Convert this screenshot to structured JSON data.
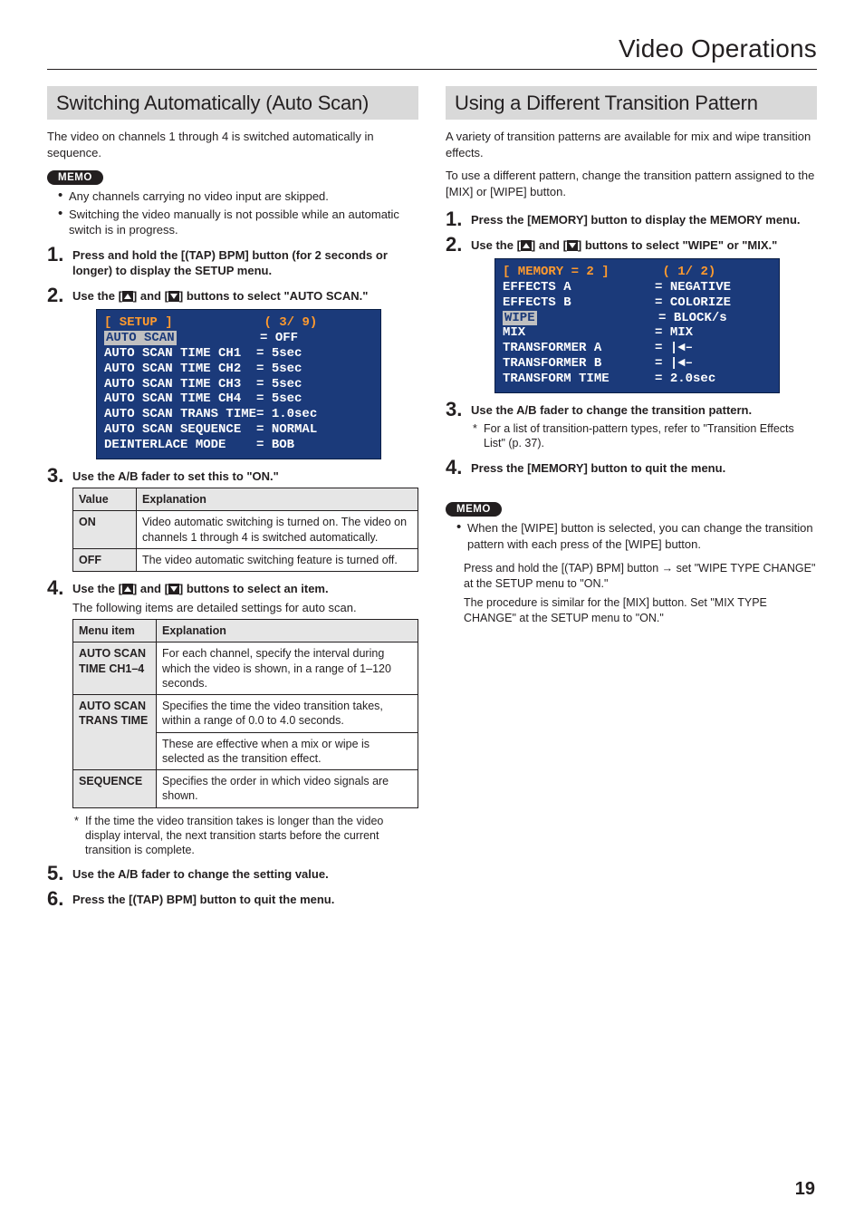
{
  "header": {
    "title": "Video Operations"
  },
  "left": {
    "section_title": "Switching Automatically (Auto Scan)",
    "intro": "The video on channels 1 through 4 is switched automatically in sequence.",
    "memo_label": "MEMO",
    "memo_items": [
      "Any channels carrying no video input are skipped.",
      "Switching the video manually is not possible while an automatic switch is in progress."
    ],
    "steps": {
      "s1": "Press and hold the [(TAP) BPM] button (for 2 seconds or longer) to display the SETUP menu.",
      "s2a": "Use the [",
      "s2b": "] and [",
      "s2c": "] buttons to select \"AUTO SCAN.\"",
      "s3": "Use the A/B fader to set this to \"ON.\"",
      "s4a": "Use the [",
      "s4b": "] and [",
      "s4c": "] buttons to select an item.",
      "s4_body": "The following items are detailed settings for auto scan.",
      "s5": "Use the A/B fader to change the setting value.",
      "s6": "Press the [(TAP) BPM] button to quit the menu."
    },
    "lcd": {
      "l1a": "[ SETUP ]",
      "l1b": "( 3/ 9)",
      "l2a": "AUTO SCAN",
      "l2b": "= OFF",
      "l3": "AUTO SCAN TIME CH1  = 5sec",
      "l4": "AUTO SCAN TIME CH2  = 5sec",
      "l5": "AUTO SCAN TIME CH3  = 5sec",
      "l6": "AUTO SCAN TIME CH4  = 5sec",
      "l7": "AUTO SCAN TRANS TIME= 1.0sec",
      "l8": "AUTO SCAN SEQUENCE  = NORMAL",
      "l9": "DEINTERLACE MODE    = BOB"
    },
    "table1": {
      "h1": "Value",
      "h2": "Explanation",
      "r1a": "ON",
      "r1b": "Video automatic switching is turned on. The video on channels 1 through 4 is switched automatically.",
      "r2a": "OFF",
      "r2b": "The video automatic switching feature is turned off."
    },
    "table2": {
      "h1": "Menu item",
      "h2": "Explanation",
      "r1a": "AUTO SCAN TIME CH1–4",
      "r1b": "For each channel, specify the interval during which the video is shown, in a range of 1–120 seconds.",
      "r2a": "AUTO SCAN TRANS TIME",
      "r2b1": "Specifies the time the video transition takes, within a range of 0.0 to 4.0 seconds.",
      "r2b2": "These are effective when a mix or wipe is selected as the transition effect.",
      "r3a": "SEQUENCE",
      "r3b": "Specifies the order in which video signals are shown."
    },
    "footnote": "If the time the video transition takes is longer than the video display interval, the next transition starts before the current transition is complete."
  },
  "right": {
    "section_title": "Using a Different Transition Pattern",
    "intro1": "A variety of transition patterns are available for mix and wipe transition effects.",
    "intro2": "To use a different pattern, change the transition pattern assigned to the [MIX] or [WIPE] button.",
    "steps": {
      "s1": "Press the [MEMORY] button to display the MEMORY menu.",
      "s2a": "Use the [",
      "s2b": "] and [",
      "s2c": "] buttons to select \"WIPE\" or \"MIX.\"",
      "s3": "Use the A/B fader to change the transition pattern.",
      "s3_foot": "For a list of transition-pattern types, refer to \"Transition Effects List\" (p. 37).",
      "s4": "Press the [MEMORY] button to quit the menu."
    },
    "lcd": {
      "l1a": "[ MEMORY = 2 ]",
      "l1b": "( 1/ 2)",
      "l2": "EFFECTS A           = NEGATIVE",
      "l3": "EFFECTS B           = COLORIZE",
      "l4a": "WIPE",
      "l4b": "= BLOCK/s",
      "l5": "MIX                 = MIX",
      "l6": "TRANSFORMER A       = |◄–",
      "l7": "TRANSFORMER B       = |◄–",
      "l8": "TRANSFORM TIME      = 2.0sec"
    },
    "memo_label": "MEMO",
    "memo_bullet": "When the [WIPE] button is selected, you can change the transition pattern with each press of the [WIPE] button.",
    "memo_p1a": "Press and hold the [(TAP) BPM] button ",
    "memo_p1b": " set \"WIPE TYPE CHANGE\" at the SETUP menu to \"ON.\"",
    "memo_p2": "The procedure is similar for the [MIX] button. Set \"MIX TYPE CHANGE\" at the SETUP menu to \"ON.\""
  },
  "page_number": "19"
}
